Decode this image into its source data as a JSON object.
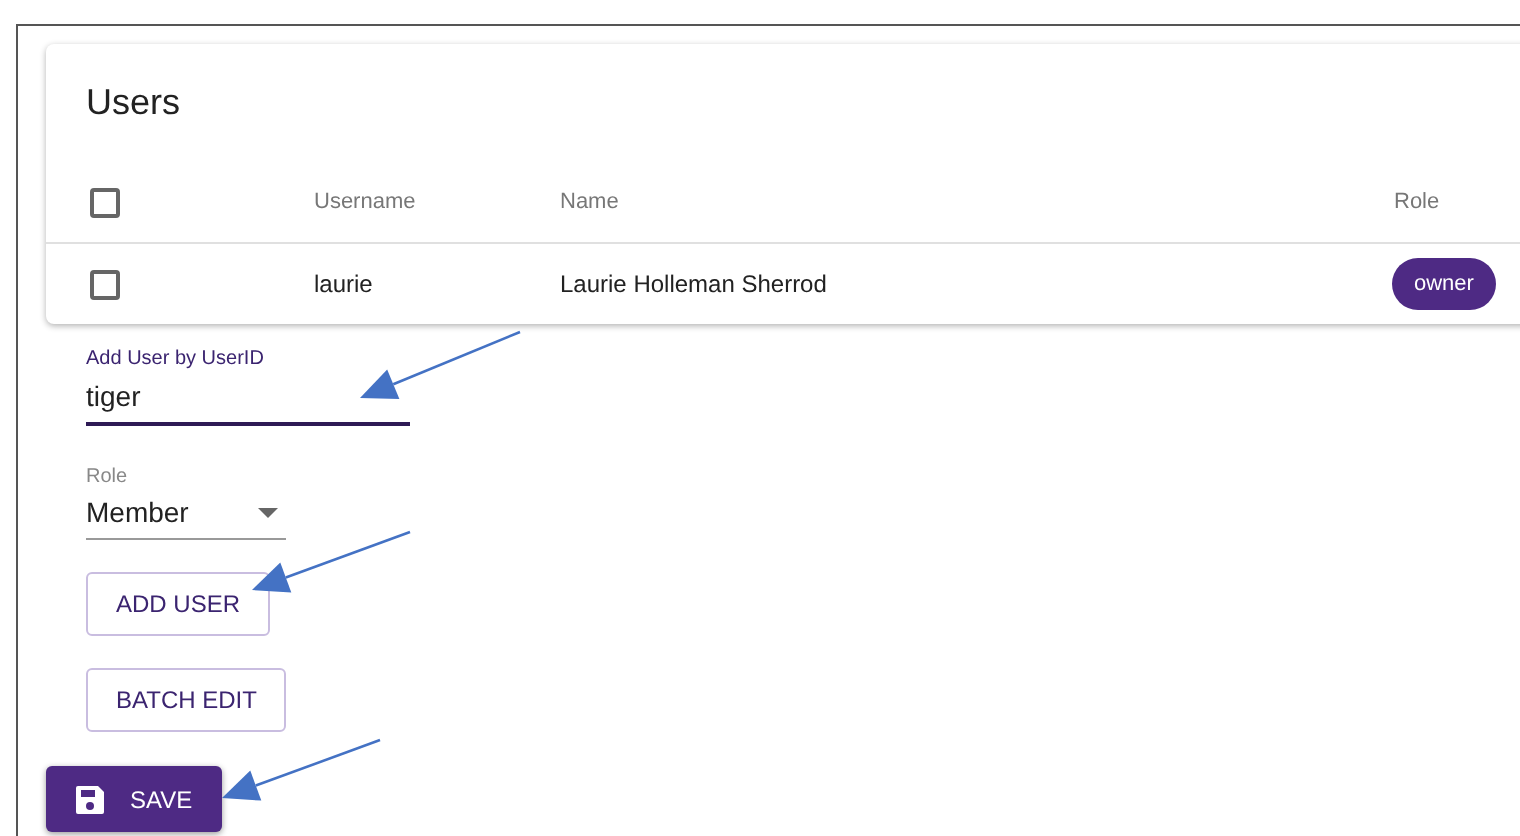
{
  "card": {
    "title": "Users"
  },
  "table": {
    "header_checkbox": {
      "checked": false
    },
    "columns": [
      "Username",
      "Name",
      "Role"
    ],
    "rows": [
      {
        "checked": false,
        "username": "laurie",
        "name": "Laurie Holleman Sherrod",
        "role": "owner"
      }
    ]
  },
  "add_user_field": {
    "label": "Add User by UserID",
    "value": "tiger",
    "focused": true
  },
  "role_select": {
    "label": "Role",
    "value": "Member"
  },
  "buttons": [
    {
      "label": "ADD USER",
      "kind": "outlined"
    },
    {
      "label": "BATCH EDIT",
      "kind": "outlined"
    },
    {
      "label": "SAVE",
      "kind": "save"
    }
  ]
}
